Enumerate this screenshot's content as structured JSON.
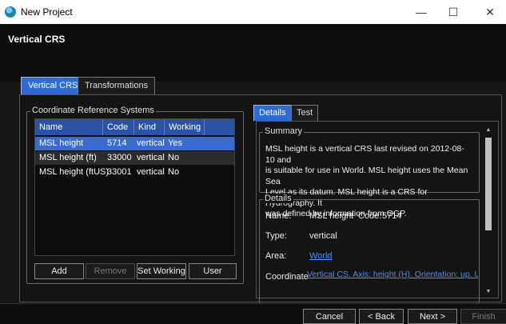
{
  "window": {
    "title": "New Project",
    "minimize": "—",
    "maximize": "☐",
    "close": "✕"
  },
  "header": {
    "title": "Vertical CRS"
  },
  "outer_tabs": [
    {
      "label": "Vertical CRS",
      "active": true
    },
    {
      "label": "Transformations",
      "active": false
    }
  ],
  "crs_group": {
    "label": "Coordinate Reference Systems",
    "columns": [
      "Name",
      "Code",
      "Kind",
      "Working"
    ],
    "rows": [
      {
        "name": "MSL height",
        "code": "5714",
        "kind": "vertical",
        "working": "Yes"
      },
      {
        "name": "MSL height (ft)",
        "code": "33000",
        "kind": "vertical",
        "working": "No"
      },
      {
        "name": "MSL height (ftUS)",
        "code": "33001",
        "kind": "vertical",
        "working": "No"
      }
    ],
    "buttons": {
      "add": "Add",
      "remove": "Remove",
      "set_working": "Set Working",
      "user": "User"
    }
  },
  "detail_tabs": [
    {
      "label": "Details",
      "active": true
    },
    {
      "label": "Test",
      "active": false
    }
  ],
  "summary": {
    "label": "Summary",
    "lines": [
      "MSL height is a vertical CRS last revised on 2012-08-10 and",
      "is suitable for use in World. MSL height uses the Mean Sea",
      "Level as its datum. MSL height is a CRS for Hydrography. It",
      "was defined by information from OGP."
    ]
  },
  "details": {
    "label": "Details",
    "name_label": "Name:",
    "name_value": "MSL height",
    "code_label": "Code:",
    "code_value": "5714",
    "type_label": "Type:",
    "type_value": "vertical",
    "area_label": "Area:",
    "area_value": "World",
    "coordinate_label": "Coordinate",
    "coordinate_value": "Vertical CS. Axis: height (H). Orientation: up. Up"
  },
  "footer": {
    "cancel": "Cancel",
    "back": "< Back",
    "next": "Next >",
    "finish": "Finish"
  },
  "colors": {
    "accent": "#2f6bd4",
    "link": "#4a90ff",
    "selection": "#3a6bd0"
  }
}
